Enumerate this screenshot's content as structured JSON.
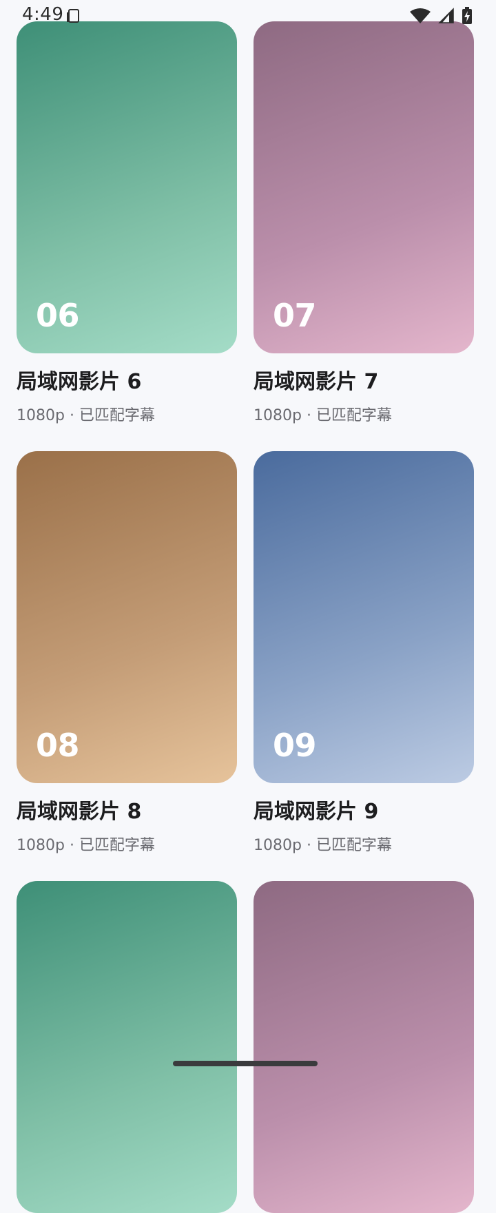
{
  "status_bar": {
    "time": "4:49",
    "icons": [
      "sim-card-icon",
      "wifi-icon",
      "cell-signal-icon",
      "battery-charging-icon"
    ]
  },
  "cards": [
    {
      "number": "06",
      "title": "局域网影片 6",
      "meta": "1080p · 已匹配字幕",
      "gradient": [
        "#3e8f77",
        "#a4dcc7"
      ]
    },
    {
      "number": "07",
      "title": "局域网影片 7",
      "meta": "1080p · 已匹配字幕",
      "gradient": [
        "#8e6a82",
        "#e4b6cc"
      ]
    },
    {
      "number": "08",
      "title": "局域网影片 8",
      "meta": "1080p · 已匹配字幕",
      "gradient": [
        "#9a7049",
        "#e6c39b"
      ]
    },
    {
      "number": "09",
      "title": "局域网影片 9",
      "meta": "1080p · 已匹配字幕",
      "gradient": [
        "#4a6b9d",
        "#bccbe3"
      ]
    },
    {
      "number": "",
      "title": "",
      "meta": "",
      "gradient": [
        "#3e8f77",
        "#a4dcc7"
      ]
    },
    {
      "number": "",
      "title": "",
      "meta": "",
      "gradient": [
        "#8e6a82",
        "#e4b6cc"
      ]
    }
  ]
}
